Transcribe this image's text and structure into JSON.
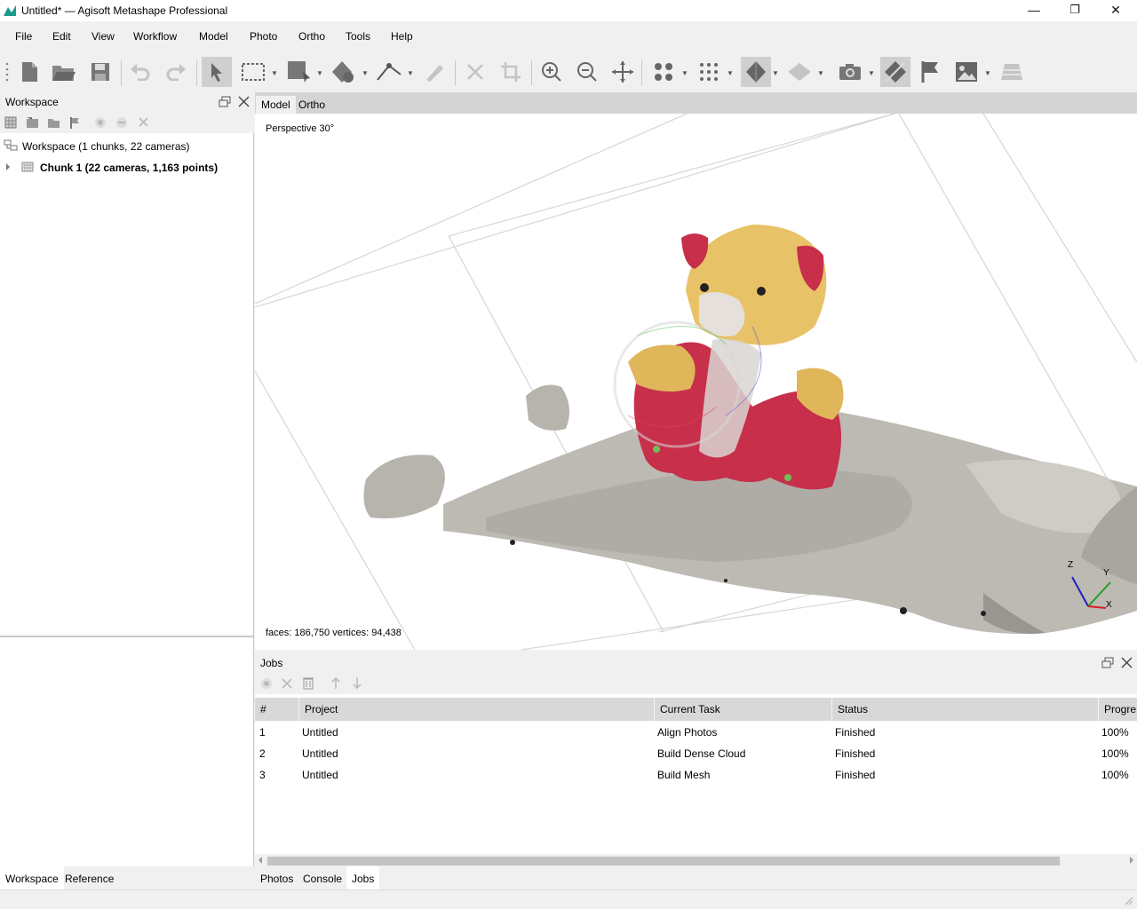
{
  "window": {
    "title": "Untitled* — Agisoft Metashape Professional",
    "controls": {
      "minimize": "—",
      "restore": "❐",
      "close": "✕"
    }
  },
  "menu": {
    "items": [
      {
        "label": "File"
      },
      {
        "label": "Edit"
      },
      {
        "label": "View"
      },
      {
        "label": "Workflow"
      },
      {
        "label": "Model"
      },
      {
        "label": "Photo"
      },
      {
        "label": "Ortho"
      },
      {
        "label": "Tools"
      },
      {
        "label": "Help"
      }
    ]
  },
  "toolbar": {
    "buttons": [
      "new-icon",
      "open-icon",
      "save-icon",
      "undo-icon",
      "redo-icon",
      "navigation-icon",
      "rectangle-selection-icon",
      "move-object-icon",
      "rotate-object-icon",
      "ruler-icon",
      "draw-polyline-icon",
      "delete-icon",
      "crop-icon",
      "zoom-in-icon",
      "zoom-out-icon",
      "reset-view-icon",
      "show-points-icon",
      "show-dense-cloud-icon",
      "show-model-icon",
      "show-tiled-model-icon",
      "show-cameras-icon",
      "show-markers-icon",
      "show-shapes-icon",
      "show-dem-icon",
      "show-region-icon"
    ]
  },
  "workspace": {
    "panel_title": "Workspace",
    "root_label": "Workspace (1 chunks, 22 cameras)",
    "chunk_label": "Chunk 1 (22 cameras, 1,163 points)",
    "tabs": [
      {
        "label": "Workspace",
        "active": true
      },
      {
        "label": "Reference",
        "active": false
      }
    ]
  },
  "view": {
    "tabs": [
      {
        "label": "Model",
        "active": true
      },
      {
        "label": "Ortho",
        "active": false
      }
    ],
    "projection_label": "Perspective 30°",
    "stats_label": "faces: 186,750 vertices: 94,438",
    "axes": {
      "x": "X",
      "y": "Y",
      "z": "Z"
    }
  },
  "jobs": {
    "panel_title": "Jobs",
    "columns": [
      "#",
      "Project",
      "Current Task",
      "Status",
      "Progre"
    ],
    "rows": [
      {
        "num": "1",
        "project": "Untitled",
        "task": "Align Photos",
        "status": "Finished",
        "progress": "100%"
      },
      {
        "num": "2",
        "project": "Untitled",
        "task": "Build Dense Cloud",
        "status": "Finished",
        "progress": "100%"
      },
      {
        "num": "3",
        "project": "Untitled",
        "task": "Build Mesh",
        "status": "Finished",
        "progress": "100%"
      }
    ]
  },
  "bottom_tabs": [
    {
      "label": "Photos",
      "active": false
    },
    {
      "label": "Console",
      "active": false
    },
    {
      "label": "Jobs",
      "active": true
    }
  ],
  "colors": {
    "accent_teal": "#1a9a8a",
    "header_grey": "#d8d8d8",
    "tab_strip": "#d4d4d4"
  }
}
